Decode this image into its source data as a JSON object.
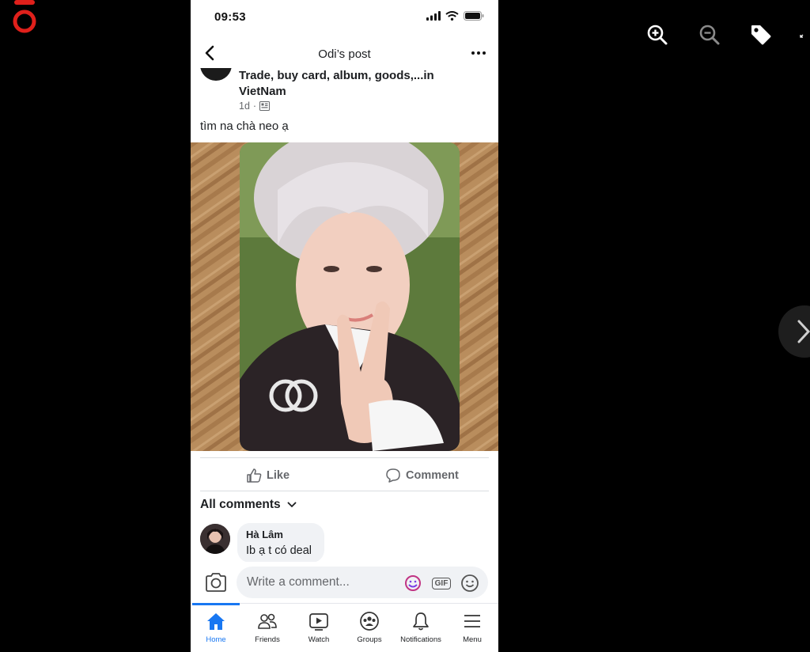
{
  "viewer": {
    "zoom_in_icon": "zoom-in-icon",
    "zoom_out_icon": "zoom-out-icon",
    "tag_icon": "tag-icon",
    "next_icon": "chevron-right-icon",
    "brand_color": "#e0201b"
  },
  "status_bar": {
    "time": "09:53"
  },
  "header": {
    "title": "Odi’s post"
  },
  "post": {
    "group_name": "Trade, buy card, album, goods,...in VietNam",
    "time_ago": "1d",
    "separator": "·",
    "text": "tìm na chà neo ạ",
    "photo": "photocard-image"
  },
  "actions": {
    "like_label": "Like",
    "comment_label": "Comment"
  },
  "comments": {
    "filter_label": "All comments",
    "items": [
      {
        "author": "Hà Lâm",
        "text": "Ib ạ t có deal"
      }
    ]
  },
  "composer": {
    "placeholder": "Write a comment...",
    "gif_label": "GIF"
  },
  "tabbar": {
    "active_color": "#1877f2",
    "tabs": [
      {
        "label": "Home"
      },
      {
        "label": "Friends"
      },
      {
        "label": "Watch"
      },
      {
        "label": "Groups"
      },
      {
        "label": "Notifications"
      },
      {
        "label": "Menu"
      }
    ]
  }
}
